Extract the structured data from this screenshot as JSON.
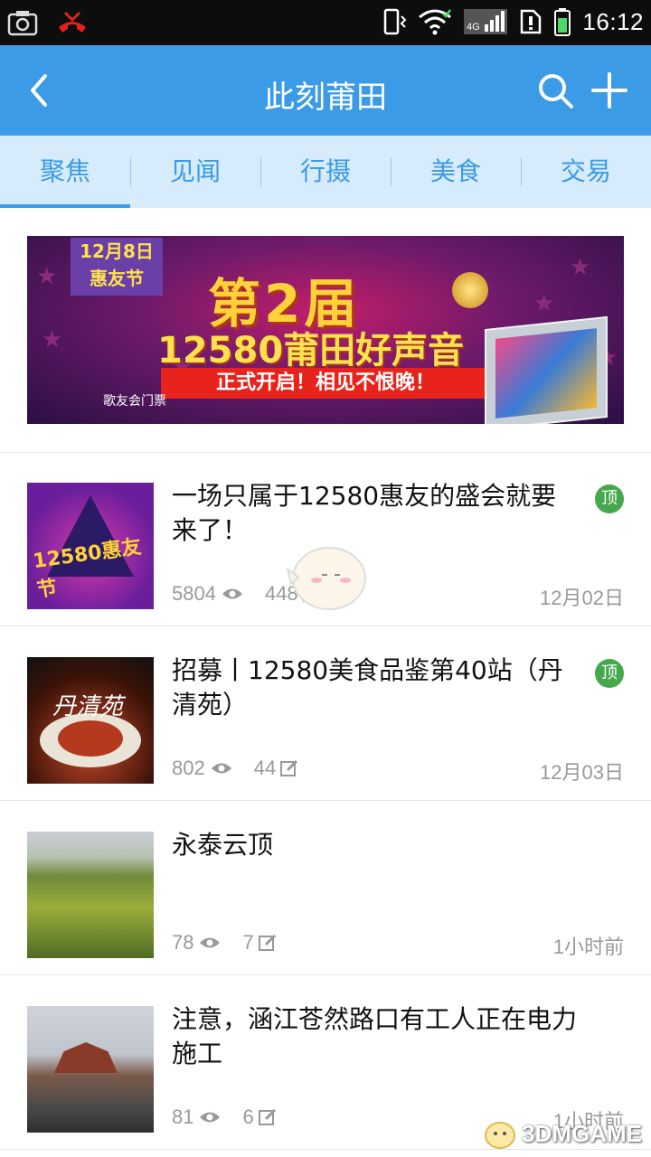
{
  "status_bar": {
    "time": "16:12",
    "network": "4G"
  },
  "app_bar": {
    "title": "此刻莆田"
  },
  "tabs": [
    {
      "label": "聚焦",
      "active": true
    },
    {
      "label": "见闻",
      "active": false
    },
    {
      "label": "行摄",
      "active": false
    },
    {
      "label": "美食",
      "active": false
    },
    {
      "label": "交易",
      "active": false
    }
  ],
  "banner": {
    "badge_date": "12月8日",
    "badge_name": "惠友节",
    "headline": "第2届",
    "subhead": "12580莆田好声音",
    "strip": "正式开启！相见不恨晚！",
    "small_text": "歌友会门票"
  },
  "feed": [
    {
      "title": "一场只属于12580惠友的盛会就要来了！",
      "views": "5804",
      "comments": "448",
      "date": "12月02日",
      "pinned": true,
      "pin_label": "顶",
      "thumb_text": "12580惠友节"
    },
    {
      "title": "招募丨12580美食品鉴第40站（丹清苑）",
      "views": "802",
      "comments": "44",
      "date": "12月03日",
      "pinned": true,
      "pin_label": "顶",
      "thumb_text": "丹清苑"
    },
    {
      "title": "永泰云顶",
      "views": "78",
      "comments": "7",
      "date": "1小时前",
      "pinned": false
    },
    {
      "title": "注意，涵江苍然路口有工人正在电力施工",
      "views": "81",
      "comments": "6",
      "date": "1小时前",
      "pinned": false
    }
  ],
  "watermark": "3DMGAME",
  "colors": {
    "primary": "#3b9be6",
    "tab_bg": "#d6ebfb",
    "pin": "#45a84c",
    "meta_text": "#999999"
  }
}
